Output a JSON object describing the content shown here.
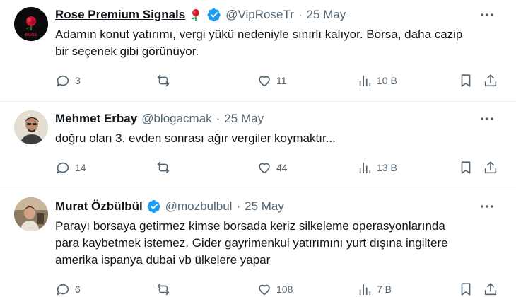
{
  "tweets": [
    {
      "name": "Rose Premium Signals",
      "handle": "@VipRoseTr",
      "separator": "·",
      "date": "25 May",
      "verified": true,
      "avatar_logo_text": "ROSE",
      "text": [
        "Adamın konut yatırımı, vergi yükü nedeniyle sınırlı kalıyor. Borsa, daha cazip",
        "bir seçenek gibi görünüyor."
      ],
      "replies": "3",
      "retweets": "",
      "likes": "11",
      "views": "10 B"
    },
    {
      "name": "Mehmet Erbay",
      "handle": "@blogacmak",
      "separator": "·",
      "date": "25 May",
      "verified": false,
      "text": [
        "doğru olan 3. evden sonrası ağır vergiler koymaktır..."
      ],
      "replies": "14",
      "retweets": "",
      "likes": "44",
      "views": "13 B"
    },
    {
      "name": "Murat Özbülbül",
      "handle": "@mozbulbul",
      "separator": "·",
      "date": "25 May",
      "verified": true,
      "text": [
        "Parayı borsaya getirmez kimse borsada keriz silkeleme operasyonlarında",
        "para kaybetmek istemez. Gider gayrimenkul yatırımını yurt dışına ingiltere",
        "amerika ispanya dubai vb ülkelere yapar"
      ],
      "replies": "6",
      "retweets": "",
      "likes": "108",
      "views": "7 B"
    }
  ],
  "colors": {
    "text": "#0f1419",
    "secondary": "#536471",
    "verified": "#1d9bf0",
    "divider": "#eff3f4",
    "rose": "#d11a2a"
  },
  "icons": [
    "more-icon",
    "reply-icon",
    "retweet-icon",
    "like-icon",
    "views-icon",
    "bookmark-icon",
    "share-icon",
    "verified-badge-icon",
    "rose-emoji-icon"
  ]
}
